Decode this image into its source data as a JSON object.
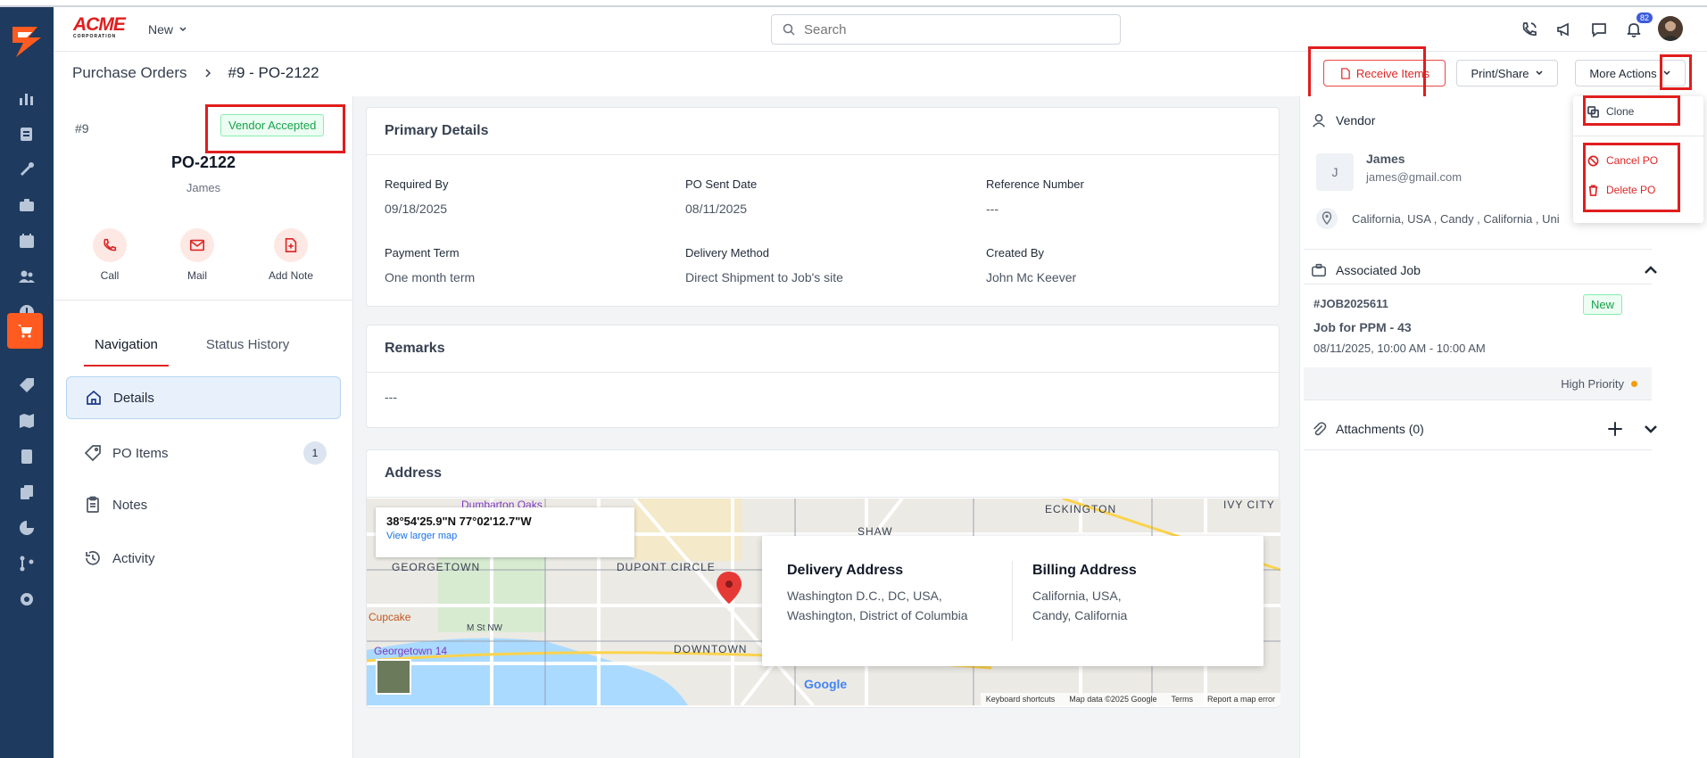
{
  "app": {
    "brand_main": "ACME",
    "brand_sub": "CORPORATION"
  },
  "header": {
    "new_label": "New",
    "search_placeholder": "Search",
    "notification_count": "82"
  },
  "breadcrumb": {
    "root": "Purchase Orders",
    "current": "#9 - PO-2122"
  },
  "actions": {
    "receive": "Receive Items",
    "print": "Print/Share",
    "more": "More Actions"
  },
  "more_menu": {
    "clone": "Clone",
    "cancel": "Cancel PO",
    "delete": "Delete PO"
  },
  "po": {
    "number": "#9",
    "status": "Vendor Accepted",
    "title": "PO-2122",
    "vendor_name": "James",
    "quick_actions": {
      "call": "Call",
      "mail": "Mail",
      "note": "Add Note"
    }
  },
  "tabs": {
    "navigation": "Navigation",
    "status_history": "Status History"
  },
  "nav": {
    "details": "Details",
    "po_items": "PO Items",
    "po_items_count": "1",
    "notes": "Notes",
    "activity": "Activity"
  },
  "primary": {
    "title": "Primary Details",
    "required_by_label": "Required By",
    "required_by": "09/18/2025",
    "sent_date_label": "PO Sent Date",
    "sent_date": "08/11/2025",
    "ref_label": "Reference Number",
    "ref": "---",
    "payment_label": "Payment Term",
    "payment": "One month term",
    "delivery_label": "Delivery Method",
    "delivery": "Direct Shipment to Job's site",
    "created_label": "Created By",
    "created": "John Mc Keever"
  },
  "remarks": {
    "title": "Remarks",
    "value": "---"
  },
  "address": {
    "title": "Address",
    "coords": "38°54'25.9\"N 77°02'12.7\"W",
    "view_larger": "View larger map",
    "delivery_title": "Delivery Address",
    "delivery_line1": "Washington D.C., DC, USA,",
    "delivery_line2": "Washington, District of Columbia",
    "billing_title": "Billing Address",
    "billing_line1": "California, USA,",
    "billing_line2": "Candy, California",
    "map_labels": {
      "georgetown": "GEORGETOWN",
      "dupont": "DUPONT CIRCLE",
      "shaw": "SHAW",
      "eckington": "ECKINGTON",
      "ivy": "IVY CITY",
      "downtown": "DOWNTOWN",
      "dumbarton": "Dumbarton Oaks",
      "cupcake": "Cupcake",
      "georgetown14": "Georgetown 14",
      "mstnw": "M St NW",
      "google": "Google"
    },
    "map_footer": {
      "shortcuts": "Keyboard shortcuts",
      "data": "Map data ©2025 Google",
      "terms": "Terms",
      "report": "Report a map error"
    }
  },
  "vendor": {
    "section": "Vendor",
    "initial": "J",
    "name": "James",
    "email": "james@gmail.com",
    "location": "California, USA , Candy , California , Uni"
  },
  "job": {
    "section": "Associated Job",
    "id": "#JOB2025611",
    "badge": "New",
    "name": "Job for PPM - 43",
    "time": "08/11/2025, 10:00 AM - 10:00 AM",
    "priority": "High Priority"
  },
  "attachments": {
    "label": "Attachments (0)"
  },
  "colors": {
    "accent": "#dc2626",
    "rail": "#1e3a5f",
    "active_rail": "#ff5a1f",
    "success": "#16a34a"
  }
}
